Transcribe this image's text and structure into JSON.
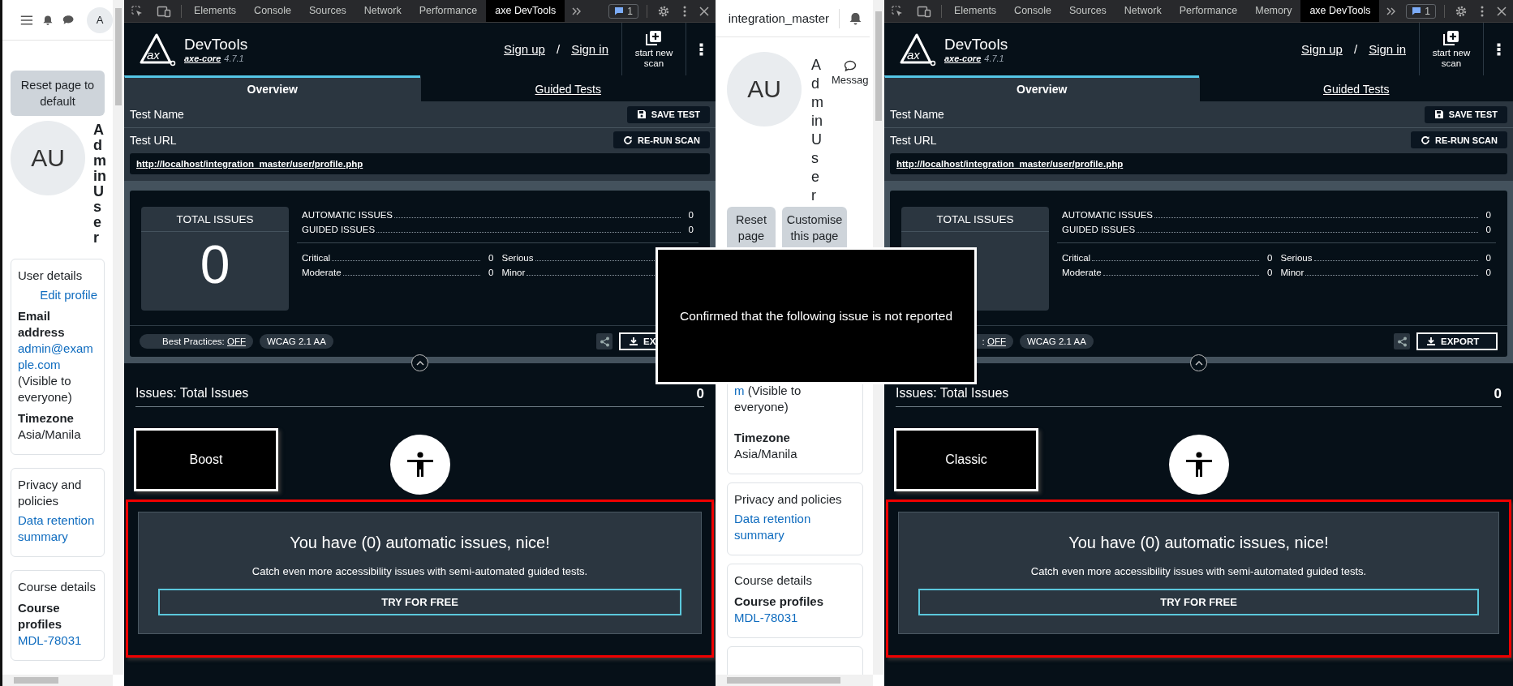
{
  "left_page": {
    "avatar_initial": "A",
    "reset_button": "Reset page to default",
    "avatar": "AU",
    "user_name": "AdminUser",
    "cards": [
      {
        "rows": [
          {
            "kind": "heading",
            "text": "User details"
          },
          {
            "kind": "action",
            "text": "Edit profile"
          },
          {
            "kind": "label",
            "text": "Email address"
          },
          {
            "kind": "link",
            "text": "admin@example.com"
          },
          {
            "kind": "text",
            "text": "(Visible to everyone)"
          },
          {
            "kind": "label",
            "text": "Timezone"
          },
          {
            "kind": "text",
            "text": "Asia/Manila"
          }
        ]
      },
      {
        "rows": [
          {
            "kind": "heading",
            "text": "Privacy and policies"
          },
          {
            "kind": "link",
            "text": "Data retention summary"
          }
        ]
      },
      {
        "rows": [
          {
            "kind": "heading",
            "text": "Course details"
          },
          {
            "kind": "label",
            "text": "Course profiles"
          },
          {
            "kind": "link",
            "text": "MDL-78031"
          }
        ]
      }
    ]
  },
  "middle_page": {
    "site_name": "integration_master",
    "avatar": "AU",
    "user_name": "AdminUser",
    "message_label": "Messag",
    "buttons": [
      "Reset page",
      "Customise this page"
    ],
    "cards": [
      {
        "rows": [
          {
            "kind": "link_note",
            "link": "m",
            "text": "(Visible to everyone)"
          },
          {
            "kind": "label",
            "text": "Timezone"
          },
          {
            "kind": "text",
            "text": "Asia/Manila"
          }
        ]
      },
      {
        "rows": [
          {
            "kind": "heading",
            "text": "Privacy and policies"
          },
          {
            "kind": "link",
            "text": "Data retention summary"
          }
        ]
      },
      {
        "rows": [
          {
            "kind": "heading",
            "text": "Course details"
          },
          {
            "kind": "label",
            "text": "Course profiles"
          },
          {
            "kind": "link",
            "text": "MDL-78031"
          }
        ]
      }
    ]
  },
  "devtools": [
    {
      "tabs": [
        {
          "label": "Elements",
          "selected": false
        },
        {
          "label": "Console",
          "selected": false
        },
        {
          "label": "Sources",
          "selected": false
        },
        {
          "label": "Network",
          "selected": false
        },
        {
          "label": "Performance",
          "selected": false
        },
        {
          "label": "axe DevTools",
          "selected": true
        }
      ],
      "issues_badge": "1",
      "logo_text": "ax",
      "brand": "DevTools",
      "engine_link": "axe-core",
      "version": "4.7.1",
      "sign_up": "Sign up",
      "separator": "/",
      "sign_in": "Sign in",
      "new_scan": "start new scan",
      "views": [
        {
          "label": "Overview",
          "selected": true
        },
        {
          "label": "Guided Tests",
          "selected": false
        }
      ],
      "test_name_label": "Test Name",
      "save_button": "SAVE TEST",
      "test_url_label": "Test URL",
      "rerun_button": "RE-RUN SCAN",
      "url": "http://localhost/integration_master/user/profile.php",
      "total_label": "TOTAL ISSUES",
      "total": "0",
      "issue_types": [
        {
          "label": "AUTOMATIC ISSUES",
          "value": "0"
        },
        {
          "label": "GUIDED ISSUES",
          "value": "0"
        }
      ],
      "impacts": [
        {
          "label": "Critical",
          "value": "0"
        },
        {
          "label": "Serious"
        },
        {
          "label": "Moderate",
          "value": "0"
        },
        {
          "label": "Minor"
        }
      ],
      "best_practices_label": "Best Practices:",
      "best_practices": "OFF",
      "standard": "WCAG 2.1 AA",
      "export_button": "EX",
      "issues_heading": "Issues: Total Issues",
      "issues_count": "0",
      "mode_button": "Boost",
      "congrats": "You have (0) automatic issues, nice!",
      "pitch": "Catch even more accessibility issues with semi-automated guided tests.",
      "cta": "TRY FOR FREE"
    },
    {
      "tabs": [
        {
          "label": "Elements",
          "selected": false
        },
        {
          "label": "Console",
          "selected": false
        },
        {
          "label": "Sources",
          "selected": false
        },
        {
          "label": "Network",
          "selected": false
        },
        {
          "label": "Performance",
          "selected": false
        },
        {
          "label": "Memory",
          "selected": false
        },
        {
          "label": "axe DevTools",
          "selected": true
        }
      ],
      "issues_badge": "1",
      "logo_text": "ax",
      "brand": "DevTools",
      "engine_link": "axe-core",
      "version": "4.7.1",
      "sign_up": "Sign up",
      "separator": "/",
      "sign_in": "Sign in",
      "new_scan": "start new scan",
      "views": [
        {
          "label": "Overview",
          "selected": true
        },
        {
          "label": "Guided Tests",
          "selected": false
        }
      ],
      "test_name_label": "Test Name",
      "save_button": "SAVE TEST",
      "test_url_label": "Test URL",
      "rerun_button": "RE-RUN SCAN",
      "url": "http://localhost/integration_master/user/profile.php",
      "total_label": "TOTAL ISSUES",
      "issue_types": [
        {
          "label": "AUTOMATIC ISSUES",
          "value": "0"
        },
        {
          "label": "GUIDED ISSUES",
          "value": "0"
        }
      ],
      "impacts": [
        {
          "label": "Critical",
          "value": "0"
        },
        {
          "label": "Serious",
          "value": "0"
        },
        {
          "label": "Moderate",
          "value": "0"
        },
        {
          "label": "Minor",
          "value": "0"
        }
      ],
      "best_practices_label": ":",
      "best_practices": "OFF",
      "standard": "WCAG 2.1 AA",
      "export_button": "EXPORT",
      "issues_heading": "Issues: Total Issues",
      "issues_count": "0",
      "mode_button": "Classic",
      "congrats": "You have (0) automatic issues, nice!",
      "pitch": "Catch even more accessibility issues with semi-automated guided tests.",
      "cta": "TRY FOR FREE"
    }
  ],
  "overlay": {
    "text": "Confirmed that the following issue is not reported"
  }
}
